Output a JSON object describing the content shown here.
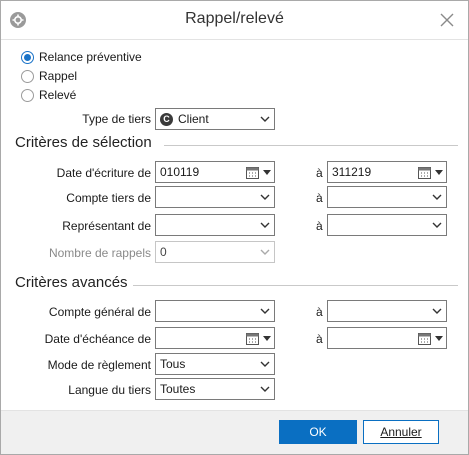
{
  "window": {
    "title": "Rappel/relevé"
  },
  "icons": {
    "app": "app-settings-icon",
    "close": "close-icon",
    "calendar": "calendar-icon",
    "dropdown": "chevron-down-icon",
    "client": "client-badge-icon"
  },
  "colors": {
    "accent": "#0a6fc2",
    "radio_checked": "#1a73c8"
  },
  "mode": {
    "options": [
      {
        "label": "Relance préventive",
        "selected": true
      },
      {
        "label": "Rappel",
        "selected": false
      },
      {
        "label": "Relevé",
        "selected": false
      }
    ]
  },
  "type_tiers": {
    "label": "Type de tiers",
    "badge": "C",
    "value": "Client"
  },
  "selection": {
    "title": "Critères de sélection",
    "date_ecriture": {
      "label": "Date d'écriture de",
      "from": "010119",
      "to_label": "à",
      "to": "311219"
    },
    "compte_tiers": {
      "label": "Compte tiers de",
      "from": "",
      "to_label": "à",
      "to": ""
    },
    "representant": {
      "label": "Représentant de",
      "from": "",
      "to_label": "à",
      "to": ""
    },
    "nombre_rappels": {
      "label": "Nombre de rappels",
      "value": "0"
    }
  },
  "avances": {
    "title": "Critères avancés",
    "compte_general": {
      "label": "Compte général de",
      "from": "",
      "to_label": "à",
      "to": ""
    },
    "date_echeance": {
      "label": "Date d'échéance de",
      "from": "",
      "to_label": "à",
      "to": ""
    },
    "mode_reglement": {
      "label": "Mode de règlement",
      "value": "Tous"
    },
    "langue_tiers": {
      "label": "Langue du tiers",
      "value": "Toutes"
    }
  },
  "footer": {
    "ok_label": "OK",
    "cancel_label": "Annuler"
  }
}
